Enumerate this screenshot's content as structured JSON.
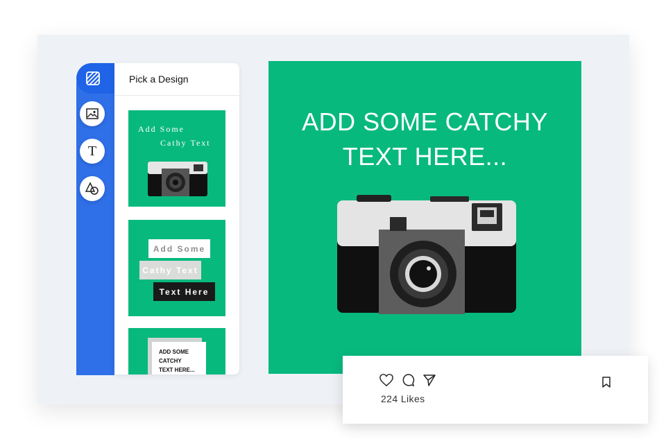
{
  "panel": {
    "title": "Pick a Design"
  },
  "templates": [
    {
      "line1": "Add Some",
      "line2": "Cathy Text"
    },
    {
      "line1": "Add Some",
      "line2": "Cathy Text",
      "line3": "Text Here"
    },
    {
      "line1": "ADD SOME",
      "line2": "CATCHY",
      "line3": "TEXT HERE..."
    }
  ],
  "preview": {
    "headline_line1": "ADD SOME CATCHY",
    "headline_line2": "TEXT HERE..."
  },
  "post": {
    "likes": "224 Likes"
  },
  "colors": {
    "accent": "#2f6fe8",
    "template_green": "#08b97e"
  },
  "icons": [
    "layers-icon",
    "image-icon",
    "text-icon",
    "shapes-icon",
    "heart-icon",
    "comment-icon",
    "share-icon",
    "bookmark-icon"
  ]
}
